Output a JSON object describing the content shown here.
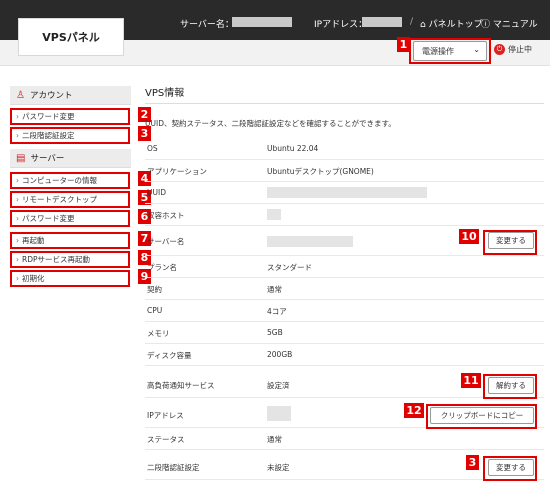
{
  "header": {
    "server_name_label": "サーバー名：",
    "ip_label": "IPアドレス：",
    "separator": "/",
    "panel_top": "パネルトップ",
    "manual": "マニュアル",
    "logo": "VPSパネル"
  },
  "power": {
    "select_value": "電源操作",
    "status": "停止中"
  },
  "sidebar": {
    "account_heading": "アカウント",
    "account_items": [
      "パスワード変更",
      "二段階認証設定"
    ],
    "server_heading": "サーバー",
    "server_items": [
      "コンピューターの情報",
      "リモートデスクトップ",
      "パスワード変更",
      "再起動",
      "RDPサービス再起動",
      "初期化"
    ]
  },
  "main": {
    "title": "VPS情報",
    "description": "UUID、契約ステータス、二段階認証設定などを確認することができます。",
    "rows": [
      {
        "label": "OS",
        "value": "Ubuntu 22.04"
      },
      {
        "label": "アプリケーション",
        "value": "Ubuntuデスクトップ(GNOME)"
      },
      {
        "label": "UUID",
        "value": ""
      },
      {
        "label": "収容ホスト",
        "value": ""
      },
      {
        "label": "サーバー名",
        "value": "",
        "button": "変更する"
      },
      {
        "label": "プラン名",
        "value": "スタンダード"
      },
      {
        "label": "契約",
        "value": "通常"
      },
      {
        "label": "CPU",
        "value": "4コア"
      },
      {
        "label": "メモリ",
        "value": "5GB"
      },
      {
        "label": "ディスク容量",
        "value": "200GB"
      },
      {
        "label": "高負荷通知サービス",
        "value": "設定済",
        "button": "解約する"
      },
      {
        "label": "IPアドレス",
        "value": "",
        "button": "クリップボードにコピー"
      },
      {
        "label": "ステータス",
        "value": "通常"
      },
      {
        "label": "二段階認証設定",
        "value": "未設定",
        "button": "変更する"
      }
    ]
  },
  "markers": [
    "1",
    "2",
    "3",
    "4",
    "5",
    "6",
    "7",
    "8",
    "9",
    "10",
    "11",
    "12",
    "3"
  ],
  "colors": {
    "marker": "#e00000",
    "header_bg": "#2a2a2a",
    "power_icon": "#e02020"
  }
}
